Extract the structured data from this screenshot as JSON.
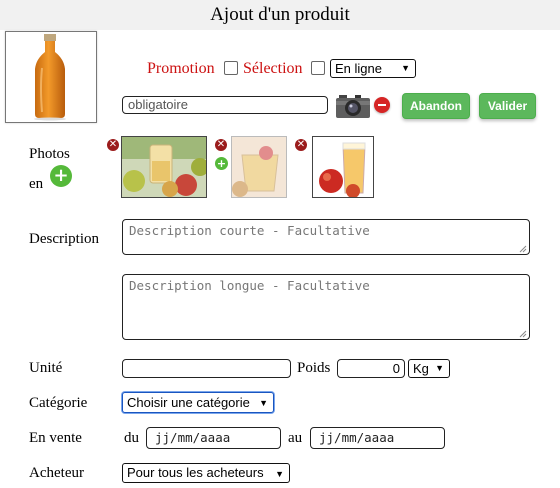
{
  "header": {
    "title": "Ajout d'un produit"
  },
  "options": {
    "promotion_label": "Promotion",
    "selection_label": "Sélection",
    "status_select": "En ligne"
  },
  "name_input": {
    "placeholder": "obligatoire"
  },
  "buttons": {
    "abandon": "Abandon",
    "valider": "Valider"
  },
  "photos": {
    "label_line1": "Photos",
    "label_line2": "en"
  },
  "description": {
    "label": "Description",
    "short_placeholder": "Description courte - Facultative",
    "long_placeholder": "Description longue - Facultative"
  },
  "unit": {
    "label": "Unité",
    "value": ""
  },
  "weight": {
    "label": "Poids",
    "value": "0",
    "unit_select": "Kg"
  },
  "category": {
    "label": "Catégorie",
    "select": "Choisir une catégorie"
  },
  "sale": {
    "label": "En vente",
    "from_label": "du",
    "from_placeholder": "jj/mm/aaaa",
    "to_label": "au",
    "to_placeholder": "jj/mm/aaaa"
  },
  "buyer": {
    "label": "Acheteur",
    "select": "Pour tous les acheteurs"
  },
  "icons": {
    "camera": "camera-icon",
    "remove": "remove-icon",
    "delete_photo": "close-icon",
    "add_photo": "plus-icon"
  },
  "colors": {
    "accent_red": "#cc1111",
    "button_green": "#5cb85c"
  }
}
